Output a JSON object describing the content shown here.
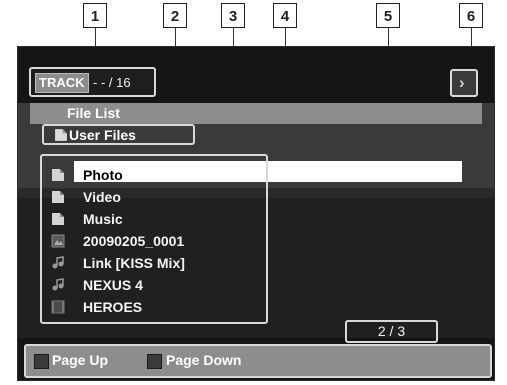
{
  "callouts": [
    "1",
    "2",
    "3",
    "4",
    "5",
    "6"
  ],
  "track": {
    "label": "TRACK",
    "count": "- - / 16"
  },
  "next_label": "›",
  "file_list_label": "File List",
  "breadcrumb": "User Files",
  "list_items": [
    {
      "label": "Photo",
      "icon": "folder-icon",
      "selected": true
    },
    {
      "label": "Video",
      "icon": "folder-icon"
    },
    {
      "label": "Music",
      "icon": "folder-icon"
    },
    {
      "label": "20090205_0001",
      "icon": "picture-file-icon"
    },
    {
      "label": "Link [KISS Mix]",
      "icon": "music-file-icon"
    },
    {
      "label": "NEXUS 4",
      "icon": "music-file-icon"
    },
    {
      "label": "HEROES",
      "icon": "video-file-icon"
    }
  ],
  "page_indicator": "2  /  3",
  "footer": {
    "page_up": "Page Up",
    "page_down": "Page Down"
  },
  "colors": {
    "highlight": "#ffffff",
    "panel": "#8d8d8d",
    "screen": "#151515"
  }
}
